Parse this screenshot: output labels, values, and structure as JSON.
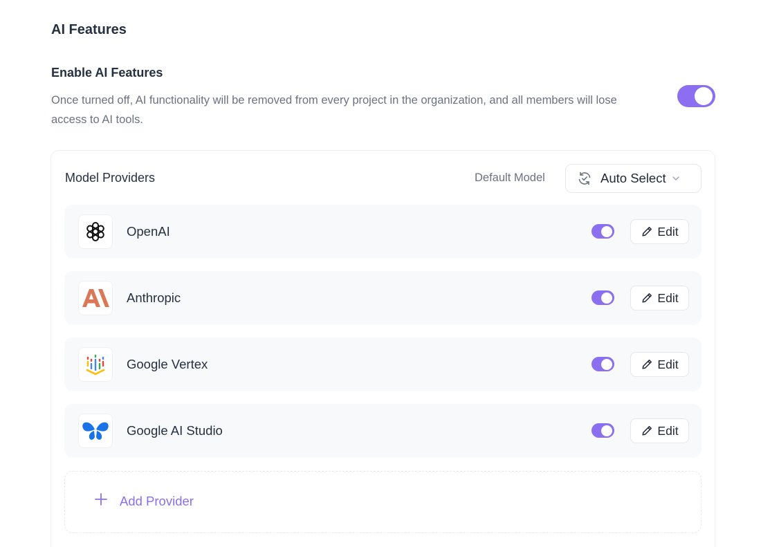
{
  "section": {
    "title": "AI Features"
  },
  "setting": {
    "title": "Enable AI Features",
    "description": "Once turned off, AI functionality will be removed from every project in the organization, and all members will lose access to AI tools.",
    "enabled": true
  },
  "panel": {
    "title": "Model Providers",
    "default_model_label": "Default Model",
    "default_model_value": "Auto Select"
  },
  "providers": [
    {
      "name": "OpenAI",
      "icon": "openai-logo-icon",
      "enabled": true,
      "edit_label": "Edit"
    },
    {
      "name": "Anthropic",
      "icon": "anthropic-logo-icon",
      "enabled": true,
      "edit_label": "Edit"
    },
    {
      "name": "Google Vertex",
      "icon": "google-vertex-logo-icon",
      "enabled": true,
      "edit_label": "Edit"
    },
    {
      "name": "Google AI Studio",
      "icon": "google-ai-studio-logo-icon",
      "enabled": true,
      "edit_label": "Edit"
    }
  ],
  "add_provider": {
    "label": "Add Provider"
  },
  "colors": {
    "accent": "#8b6ff0",
    "text": "#253041",
    "muted": "#6b7280",
    "row_bg": "#f8f9fb",
    "anthropic": "#d97757",
    "google_studio": "#1a73e8"
  }
}
